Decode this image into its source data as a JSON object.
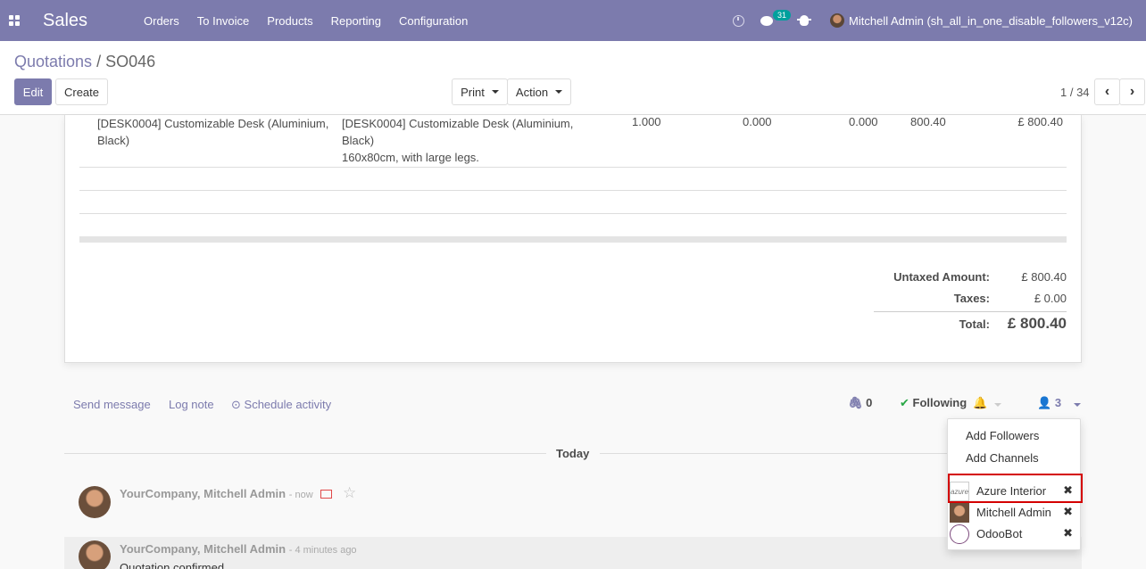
{
  "navbar": {
    "brand": "Sales",
    "menu": [
      "Orders",
      "To Invoice",
      "Products",
      "Reporting",
      "Configuration"
    ],
    "chat_count": "31",
    "user": "Mitchell Admin (sh_all_in_one_disable_followers_v12c)"
  },
  "control": {
    "breadcrumb_parent": "Quotations",
    "breadcrumb_sep": "/",
    "breadcrumb_current": "SO046",
    "edit_label": "Edit",
    "create_label": "Create",
    "print_label": "Print",
    "action_label": "Action",
    "pager": "1 / 34",
    "prev": "‹",
    "next": "›"
  },
  "order_line": {
    "product": "[DESK0004] Customizable Desk (Aluminium, Black)",
    "description_1": "[DESK0004] Customizable Desk (Aluminium,",
    "description_2": "Black)",
    "description_3": "160x80cm, with large legs.",
    "quantity": "1.000",
    "delivered": "0.000",
    "invoiced": "0.000",
    "unit_price": "800.40",
    "subtotal": "£ 800.40"
  },
  "totals": {
    "untaxed_label": "Untaxed Amount:",
    "untaxed_value": "£ 800.40",
    "taxes_label": "Taxes:",
    "taxes_value": "£ 0.00",
    "total_label": "Total:",
    "total_value": "£ 800.40"
  },
  "chatter": {
    "send_message": "Send message",
    "log_note": "Log note",
    "schedule_activity": "Schedule activity",
    "attachments": "0",
    "following": "Following",
    "followers_count": "3",
    "today": "Today",
    "messages": [
      {
        "author": "YourCompany, Mitchell Admin",
        "date": "- now"
      },
      {
        "author": "YourCompany, Mitchell Admin",
        "date": "- 4 minutes ago",
        "body": "Quotation confirmed"
      }
    ]
  },
  "followers_dropdown": {
    "add_followers": "Add Followers",
    "add_channels": "Add Channels",
    "azure_logo_text": "azure",
    "followers": [
      "Azure Interior",
      "Mitchell Admin",
      "OdooBot"
    ],
    "remove": "✖"
  },
  "colors": {
    "brand": "#7c7bad",
    "highlight": "#d40000",
    "following_check": "#28a745"
  }
}
